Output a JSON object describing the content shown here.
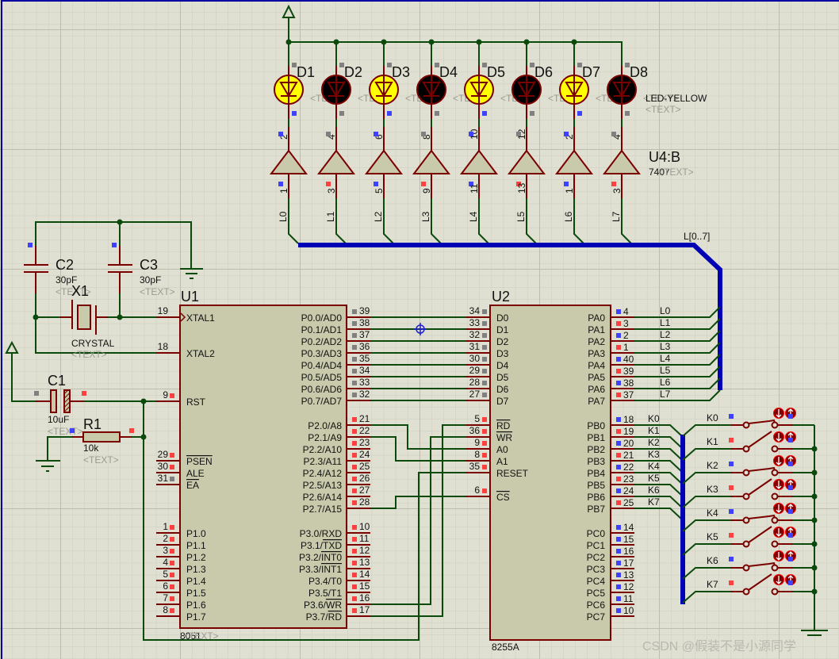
{
  "colors": {
    "background": "#e0e0d2",
    "grid_minor": "#cdcdbf",
    "grid_major": "#bfbfb0",
    "wire": "#0b4a0b",
    "pin": "#7a0000",
    "body": "#c9c9ac",
    "bus": "#0000b4",
    "led_on": "#ffff00",
    "led_off": "#000000",
    "state": {
      "low": "#4040ff",
      "high": "#ff4040",
      "float": "#808080"
    }
  },
  "leds": [
    {
      "ref": "D1",
      "state": "on",
      "text": "<TEXT>",
      "top": "float",
      "bottom": "low"
    },
    {
      "ref": "D2",
      "state": "off",
      "text": "<TEXT>",
      "top": "float",
      "bottom": "float"
    },
    {
      "ref": "D3",
      "state": "on",
      "text": "<TEXT>",
      "top": "float",
      "bottom": "low"
    },
    {
      "ref": "D4",
      "state": "off",
      "text": "<TEXT>",
      "top": "float",
      "bottom": "float"
    },
    {
      "ref": "D5",
      "state": "on",
      "text": "<TEXT>",
      "top": "float",
      "bottom": "low"
    },
    {
      "ref": "D6",
      "state": "off",
      "text": "<TEXT>",
      "top": "float",
      "bottom": "float"
    },
    {
      "ref": "D7",
      "state": "on",
      "text": "<TEXT>",
      "top": "float",
      "bottom": "low"
    },
    {
      "ref": "D8",
      "state": "off",
      "text": "<TEXT>",
      "top": "float",
      "bottom": "float"
    }
  ],
  "led_part": "LED-YELLOW",
  "led_part_text": "<TEXT>",
  "buffers": {
    "ref": "U4:B",
    "part": "7407",
    "text": "<TEXT>",
    "gates": [
      {
        "in": "1",
        "out": "2",
        "in_state": "low",
        "out_state": "low",
        "net": "L0"
      },
      {
        "in": "3",
        "out": "4",
        "in_state": "high",
        "out_state": "float",
        "net": "L1"
      },
      {
        "in": "5",
        "out": "6",
        "in_state": "low",
        "out_state": "low",
        "net": "L2"
      },
      {
        "in": "9",
        "out": "8",
        "in_state": "high",
        "out_state": "float",
        "net": "L3"
      },
      {
        "in": "11",
        "out": "10",
        "in_state": "low",
        "out_state": "low",
        "net": "L4"
      },
      {
        "in": "13",
        "out": "12",
        "in_state": "high",
        "out_state": "float",
        "net": "L5"
      },
      {
        "in": "1",
        "out": "2",
        "in_state": "low",
        "out_state": "low",
        "net": "L6"
      },
      {
        "in": "3",
        "out": "4",
        "in_state": "high",
        "out_state": "float",
        "net": "L7"
      }
    ],
    "gate_text": "<TEXT>"
  },
  "bus_label": "L[0..7]",
  "u1": {
    "ref": "U1",
    "part": "8051",
    "text": "<TEXT>",
    "left": [
      {
        "name": "XTAL1",
        "pin": "19",
        "state": ""
      },
      {
        "name": "XTAL2",
        "pin": "18",
        "state": ""
      },
      {
        "name": "RST",
        "pin": "9",
        "state": "high"
      },
      {
        "name": "",
        "bar": "PSEN",
        "pin": "29",
        "state": "high"
      },
      {
        "name": "ALE",
        "pin": "30",
        "state": "high"
      },
      {
        "name": "",
        "bar": "EA",
        "pin": "31",
        "state": "float"
      },
      {
        "name": "P1.0",
        "pin": "1",
        "state": "high"
      },
      {
        "name": "P1.1",
        "pin": "2",
        "state": "high"
      },
      {
        "name": "P1.2",
        "pin": "3",
        "state": "high"
      },
      {
        "name": "P1.3",
        "pin": "4",
        "state": "high"
      },
      {
        "name": "P1.4",
        "pin": "5",
        "state": "high"
      },
      {
        "name": "P1.5",
        "pin": "6",
        "state": "high"
      },
      {
        "name": "P1.6",
        "pin": "7",
        "state": "high"
      },
      {
        "name": "P1.7",
        "pin": "8",
        "state": "high"
      }
    ],
    "right": [
      {
        "name": "P0.0/AD0",
        "pin": "39",
        "state": "float"
      },
      {
        "name": "P0.1/AD1",
        "pin": "38",
        "state": "float"
      },
      {
        "name": "P0.2/AD2",
        "pin": "37",
        "state": "float"
      },
      {
        "name": "P0.3/AD3",
        "pin": "36",
        "state": "float"
      },
      {
        "name": "P0.4/AD4",
        "pin": "35",
        "state": "float"
      },
      {
        "name": "P0.5/AD5",
        "pin": "34",
        "state": "float"
      },
      {
        "name": "P0.6/AD6",
        "pin": "33",
        "state": "float"
      },
      {
        "name": "P0.7/AD7",
        "pin": "32",
        "state": "float"
      },
      {
        "name": "P2.0/A8",
        "pin": "21",
        "state": "high"
      },
      {
        "name": "P2.1/A9",
        "pin": "22",
        "state": "high"
      },
      {
        "name": "P2.2/A10",
        "pin": "23",
        "state": "high"
      },
      {
        "name": "P2.3/A11",
        "pin": "24",
        "state": "high"
      },
      {
        "name": "P2.4/A12",
        "pin": "25",
        "state": "high"
      },
      {
        "name": "P2.5/A13",
        "pin": "26",
        "state": "high"
      },
      {
        "name": "P2.6/A14",
        "pin": "27",
        "state": "high"
      },
      {
        "name": "P2.7/A15",
        "pin": "28",
        "state": "high"
      },
      {
        "name": "P3.0/RXD",
        "pin": "10",
        "state": "high"
      },
      {
        "name": "P3.1/",
        "bar": "TXD",
        "pin": "11",
        "state": "high"
      },
      {
        "name": "P3.2/",
        "bar": "INT0",
        "pin": "12",
        "state": "high"
      },
      {
        "name": "P3.3/",
        "bar": "INT1",
        "pin": "13",
        "state": "high"
      },
      {
        "name": "P3.4/T0",
        "pin": "14",
        "state": "high"
      },
      {
        "name": "P3.5/T1",
        "pin": "15",
        "state": "high"
      },
      {
        "name": "P3.6/",
        "bar": "WR",
        "pin": "16",
        "state": "high"
      },
      {
        "name": "P3.7/",
        "bar": "RD",
        "pin": "17",
        "state": "high"
      }
    ]
  },
  "u2": {
    "ref": "U2",
    "part": "8255A",
    "left": [
      {
        "name": "D0",
        "pin": "34",
        "state": "float"
      },
      {
        "name": "D1",
        "pin": "33",
        "state": "float"
      },
      {
        "name": "D2",
        "pin": "32",
        "state": "float"
      },
      {
        "name": "D3",
        "pin": "31",
        "state": "float"
      },
      {
        "name": "D4",
        "pin": "30",
        "state": "float"
      },
      {
        "name": "D5",
        "pin": "29",
        "state": "float"
      },
      {
        "name": "D6",
        "pin": "28",
        "state": "float"
      },
      {
        "name": "D7",
        "pin": "27",
        "state": "float"
      },
      {
        "name": "",
        "bar": "RD",
        "pin": "5",
        "state": "high"
      },
      {
        "name": "",
        "bar": "WR",
        "pin": "36",
        "state": "high"
      },
      {
        "name": "A0",
        "pin": "9",
        "state": "high"
      },
      {
        "name": "A1",
        "pin": "8",
        "state": "high"
      },
      {
        "name": "RESET",
        "pin": "35",
        "state": "high"
      },
      {
        "name": "",
        "bar": "CS",
        "pin": "6",
        "state": "high"
      }
    ],
    "right": [
      {
        "name": "PA0",
        "pin": "4",
        "state": "low",
        "net": "L0"
      },
      {
        "name": "PA1",
        "pin": "3",
        "state": "high",
        "net": "L1"
      },
      {
        "name": "PA2",
        "pin": "2",
        "state": "low",
        "net": "L2"
      },
      {
        "name": "PA3",
        "pin": "1",
        "state": "high",
        "net": "L3"
      },
      {
        "name": "PA4",
        "pin": "40",
        "state": "low",
        "net": "L4"
      },
      {
        "name": "PA5",
        "pin": "39",
        "state": "high",
        "net": "L5"
      },
      {
        "name": "PA6",
        "pin": "38",
        "state": "low",
        "net": "L6"
      },
      {
        "name": "PA7",
        "pin": "37",
        "state": "high",
        "net": "L7"
      },
      {
        "name": "PB0",
        "pin": "18",
        "state": "low",
        "net": "K0"
      },
      {
        "name": "PB1",
        "pin": "19",
        "state": "high",
        "net": "K1"
      },
      {
        "name": "PB2",
        "pin": "20",
        "state": "low",
        "net": "K2"
      },
      {
        "name": "PB3",
        "pin": "21",
        "state": "high",
        "net": "K3"
      },
      {
        "name": "PB4",
        "pin": "22",
        "state": "low",
        "net": "K4"
      },
      {
        "name": "PB5",
        "pin": "23",
        "state": "high",
        "net": "K5"
      },
      {
        "name": "PB6",
        "pin": "24",
        "state": "low",
        "net": "K6"
      },
      {
        "name": "PB7",
        "pin": "25",
        "state": "high",
        "net": "K7"
      },
      {
        "name": "PC0",
        "pin": "14",
        "state": "low"
      },
      {
        "name": "PC1",
        "pin": "15",
        "state": "low"
      },
      {
        "name": "PC2",
        "pin": "16",
        "state": "low"
      },
      {
        "name": "PC3",
        "pin": "17",
        "state": "low"
      },
      {
        "name": "PC4",
        "pin": "13",
        "state": "low"
      },
      {
        "name": "PC5",
        "pin": "12",
        "state": "low"
      },
      {
        "name": "PC6",
        "pin": "11",
        "state": "low"
      },
      {
        "name": "PC7",
        "pin": "10",
        "state": "low"
      }
    ]
  },
  "components": {
    "c1": {
      "ref": "C1",
      "value": "10uF",
      "text": "<TEXT>"
    },
    "c2": {
      "ref": "C2",
      "value": "30pF",
      "text": "<TEXT>"
    },
    "c3": {
      "ref": "C3",
      "value": "30pF",
      "text": "<TEXT>"
    },
    "x1": {
      "ref": "X1",
      "value": "CRYSTAL",
      "text": "<TEXT>"
    },
    "r1": {
      "ref": "R1",
      "value": "10k",
      "text": "<TEXT>"
    }
  },
  "switches": [
    {
      "label": "K0",
      "state": "closed",
      "marker": "low"
    },
    {
      "label": "K1",
      "state": "open",
      "marker": "high"
    },
    {
      "label": "K2",
      "state": "closed",
      "marker": "low"
    },
    {
      "label": "K3",
      "state": "open",
      "marker": "high"
    },
    {
      "label": "K4",
      "state": "closed",
      "marker": "low"
    },
    {
      "label": "K5",
      "state": "open",
      "marker": "high"
    },
    {
      "label": "K6",
      "state": "closed",
      "marker": "low"
    },
    {
      "label": "K7",
      "state": "open",
      "marker": "high"
    }
  ],
  "watermark": "CSDN @假装不是小源同学"
}
